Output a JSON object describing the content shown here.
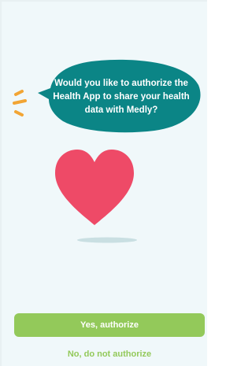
{
  "prompt": {
    "message": "Would you like to authorize the Health App to share your health data with Medly?"
  },
  "actions": {
    "authorize_label": "Yes, authorize",
    "decline_label": "No, do not authorize"
  },
  "colors": {
    "background": "#f0f8fa",
    "bubble": "#0b8586",
    "heart": "#ee4a67",
    "sparkles": "#f2a534",
    "button": "#93c95a",
    "button_text": "#ffffff",
    "link_text": "#93c95a"
  },
  "icons": {
    "sparkles": "sparkle-lines-icon",
    "heart": "heart-icon"
  }
}
